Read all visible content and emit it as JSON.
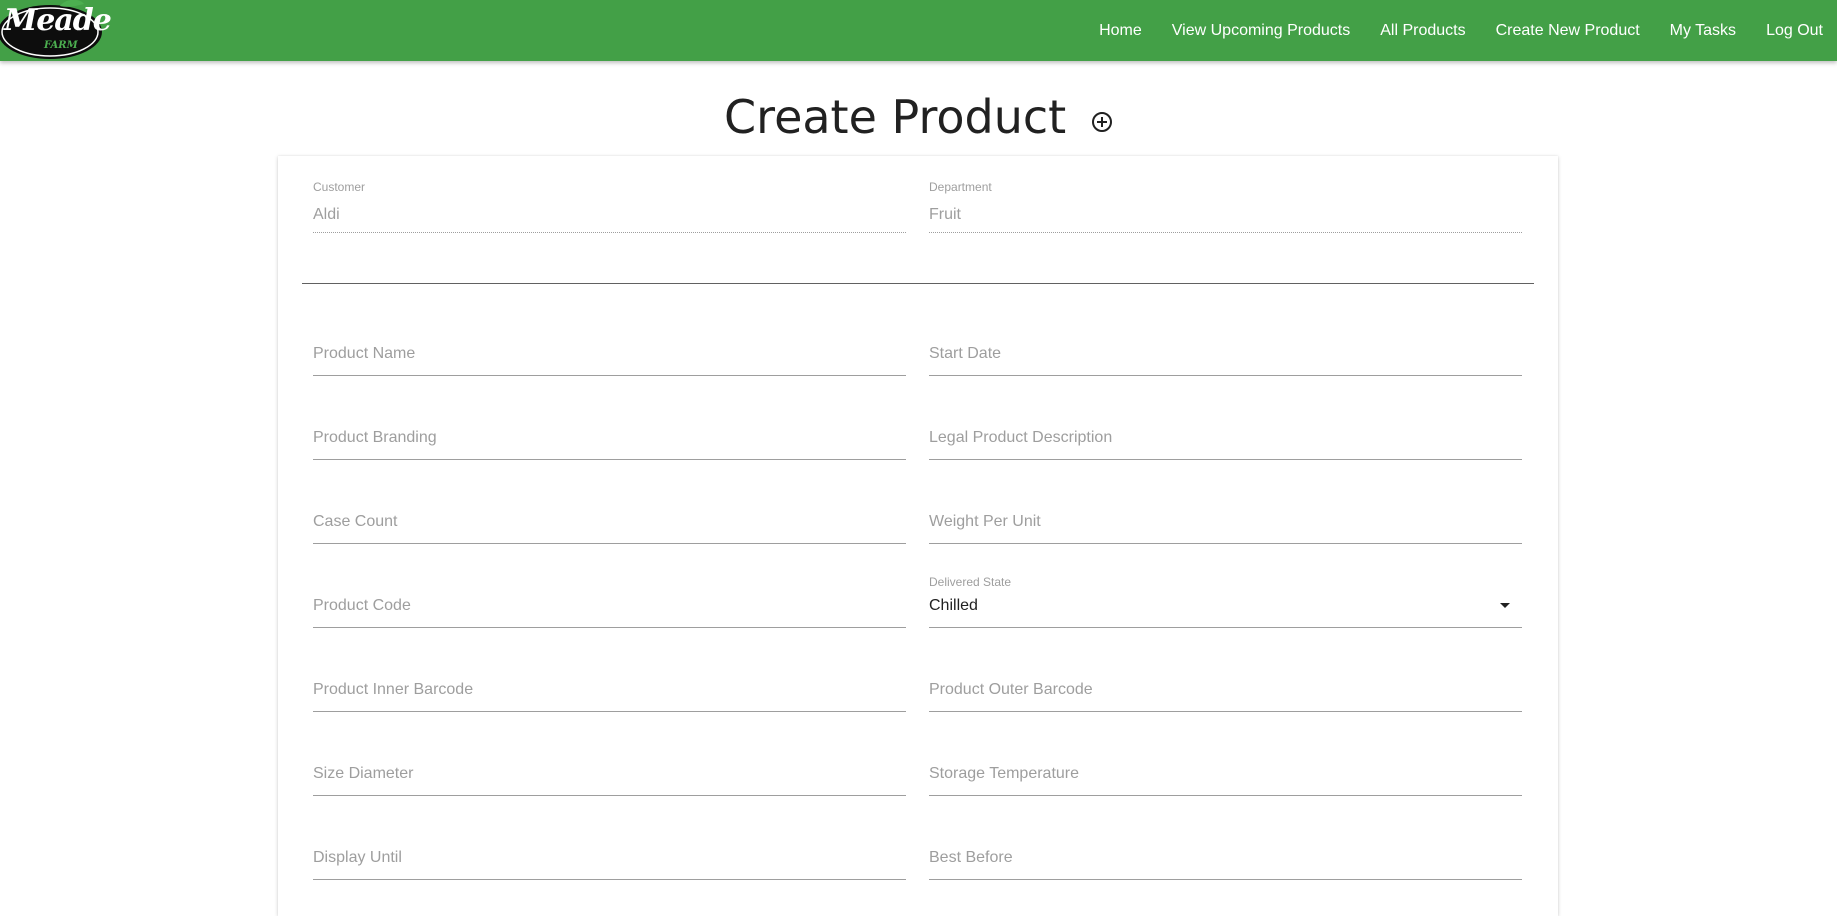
{
  "brand": {
    "name": "Meade",
    "subtitle": "FARM"
  },
  "nav": {
    "items": [
      {
        "label": "Home"
      },
      {
        "label": "View Upcoming Products"
      },
      {
        "label": "All Products"
      },
      {
        "label": "Create New Product"
      },
      {
        "label": "My Tasks"
      },
      {
        "label": "Log Out"
      }
    ]
  },
  "page": {
    "title": "Create Product",
    "title_icon": "add-circle-icon"
  },
  "form": {
    "customer": {
      "label": "Customer",
      "value": "Aldi"
    },
    "department": {
      "label": "Department",
      "value": "Fruit"
    },
    "fields": {
      "product_name": {
        "placeholder": "Product Name"
      },
      "start_date": {
        "placeholder": "Start Date"
      },
      "product_branding": {
        "placeholder": "Product Branding"
      },
      "legal_product_description": {
        "placeholder": "Legal Product Description"
      },
      "case_count": {
        "placeholder": "Case Count"
      },
      "weight_per_unit": {
        "placeholder": "Weight Per Unit"
      },
      "product_code": {
        "placeholder": "Product Code"
      },
      "delivered_state": {
        "label": "Delivered State",
        "value": "Chilled"
      },
      "product_inner_barcode": {
        "placeholder": "Product Inner Barcode"
      },
      "product_outer_barcode": {
        "placeholder": "Product Outer Barcode"
      },
      "size_diameter": {
        "placeholder": "Size Diameter"
      },
      "storage_temperature": {
        "placeholder": "Storage Temperature"
      },
      "display_until": {
        "placeholder": "Display Until"
      },
      "best_before": {
        "placeholder": "Best Before"
      }
    }
  },
  "colors": {
    "navbar": "#43a047",
    "placeholder": "#9e9e9e",
    "text": "#212121"
  }
}
